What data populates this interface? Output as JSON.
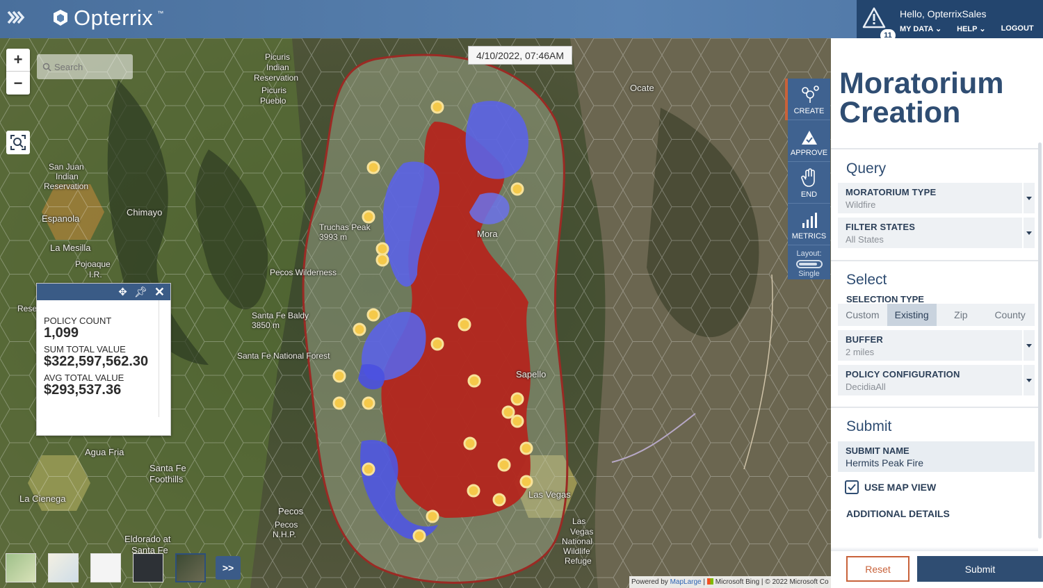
{
  "header": {
    "brand": "Opterrix",
    "brand_tm": "™",
    "alert_count": "11",
    "greeting": "Hello, OpterrixSales",
    "nav": [
      "MY DATA",
      "HELP",
      "LOGOUT"
    ]
  },
  "map": {
    "search_placeholder": "Search",
    "timestamp": "4/10/2022, 07:46AM",
    "labels": {
      "picuris": "Picuris",
      "indian": "Indian",
      "reservation": "Reservation",
      "picuris_pueblo_1": "Picuris",
      "picuris_pueblo_2": "Pueblo",
      "ocate": "Ocate",
      "san_juan_1": "San Juan",
      "san_juan_2": "Indian",
      "san_juan_3": "Reservation",
      "chimayo": "Chimayo",
      "espanola": "Espanola",
      "la_mesilla": "La Mesilla",
      "pojoaque": "Pojoaque",
      "truchas_1": "Truchas Peak",
      "truchas_2": "3993 m",
      "mora": "Mora",
      "pecos_wilderness": "Pecos Wilderness",
      "santa_fe_baldy_1": "Santa Fe Baldy",
      "santa_fe_baldy_2": "3850 m",
      "santa_fe_nf": "Santa Fe National Forest",
      "sapello": "Sapello",
      "agua_fria": "Agua Fria",
      "santa_fe_foothills_1": "Santa Fe",
      "santa_fe_foothills_2": "Foothills",
      "la_cienega": "La Cienega",
      "pecos": "Pecos",
      "pecos_nhp_1": "Pecos",
      "pecos_nhp_2": "N.H.P.",
      "las_vegas": "Las Vegas",
      "las_vegas_nwr_1": "Las",
      "las_vegas_nwr_2": "Vegas",
      "las_vegas_nwr_3": "National",
      "las_vegas_nwr_4": "Wildlife",
      "las_vegas_nwr_5": "Refuge",
      "eldorado_1": "Eldorado at",
      "eldorado_2": "Santa Fe",
      "ill": "I.R.",
      "rese": "Rese"
    },
    "infobox": {
      "policy_count_label": "POLICY COUNT",
      "policy_count": "1,099",
      "sum_label": "SUM TOTAL VALUE",
      "sum_value": "$322,597,562.30",
      "avg_label": "AVG TOTAL VALUE",
      "avg_value": "$293,537.36"
    },
    "expand_label": ">>",
    "attribution": {
      "powered": "Powered by ",
      "maplarge": "MapLarge",
      "sep": " | ",
      "bing": "Microsoft Bing",
      "copyright": " | © 2022 Microsoft Co"
    }
  },
  "rail": {
    "tools": [
      "CREATE",
      "APPROVE",
      "END",
      "METRICS"
    ],
    "layout_label": "Layout:",
    "layout_value": "Single"
  },
  "panel": {
    "title": "Moratorium Creation",
    "query_heading": "Query",
    "moratorium_type_label": "MORATORIUM TYPE",
    "moratorium_type_value": "Wildfire",
    "filter_states_label": "FILTER STATES",
    "filter_states_value": "All States",
    "select_heading": "Select",
    "selection_type_label": "SELECTION TYPE",
    "selection_options": [
      "Custom",
      "Existing",
      "Zip",
      "County"
    ],
    "selection_selected": "Existing",
    "buffer_label": "BUFFER",
    "buffer_value": "2 miles",
    "policy_config_label": "POLICY CONFIGURATION",
    "policy_config_value": "DecidiaAll",
    "submit_heading": "Submit",
    "submit_name_label": "SUBMIT NAME",
    "submit_name_value": "Hermits Peak Fire",
    "use_map_view_label": "USE MAP VIEW",
    "use_map_view_checked": true,
    "additional_details_label": "ADDITIONAL DETAILS",
    "reset_label": "Reset",
    "submit_label": "Submit"
  },
  "colors": {
    "header": "#4d74a3",
    "brand_dark": "#23456e",
    "accent": "#c8623a",
    "fire": "#b3261e",
    "policy": "#5b63e6",
    "marker": "#f5c94a"
  }
}
